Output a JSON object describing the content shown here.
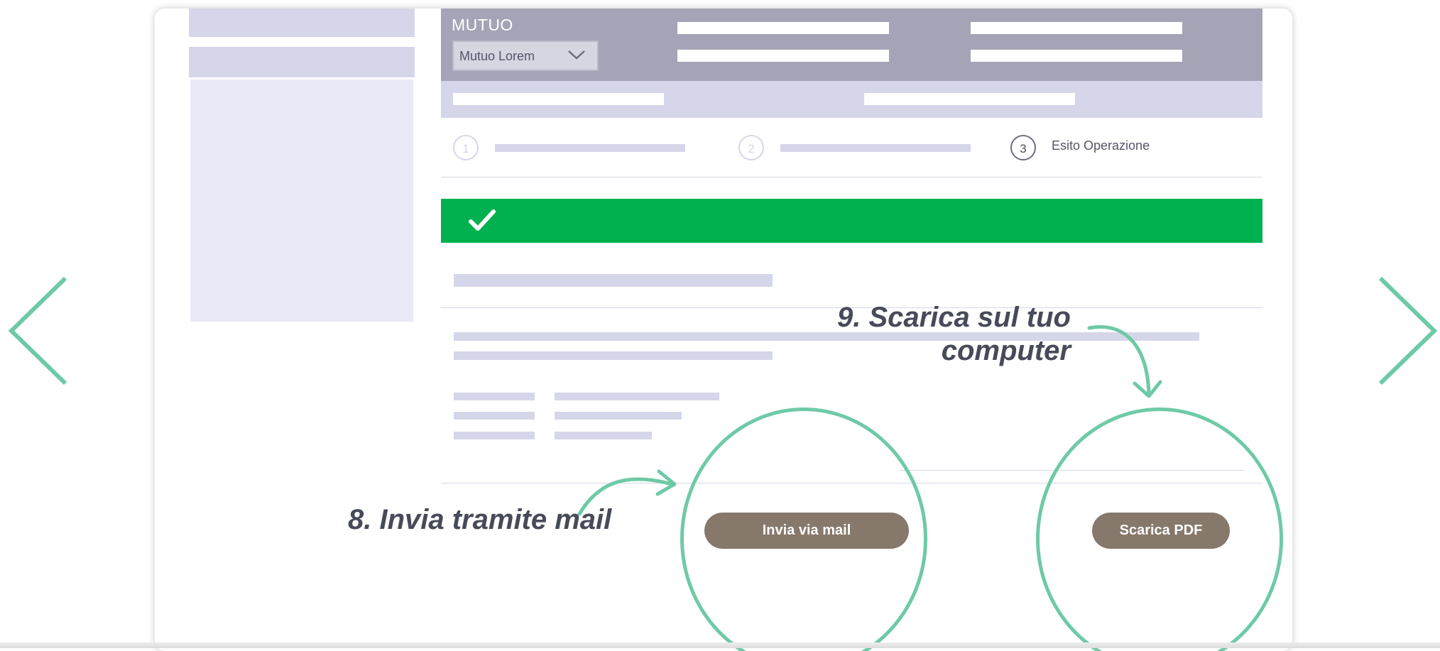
{
  "header": {
    "title": "MUTUO",
    "product_select": {
      "value": "Mutuo Lorem"
    }
  },
  "steps": [
    {
      "number": "1",
      "label": ""
    },
    {
      "number": "2",
      "label": ""
    },
    {
      "number": "3",
      "label": "Esito Operazione"
    }
  ],
  "actions": {
    "send_mail_label": "Invia via mail",
    "download_pdf_label": "Scarica PDF"
  },
  "annotations": {
    "mail": "8. Invia tramite mail",
    "download_line1": "9. Scarica sul tuo",
    "download_line2": "computer"
  },
  "icons": {
    "success": "checkmark-icon",
    "select": "chevron-down-icon",
    "prev": "chevron-left-icon",
    "next": "chevron-right-icon"
  },
  "colors": {
    "accent": "#6ecaa6",
    "success": "#01b14f",
    "button": "#86786b",
    "header": "#a5a4b6",
    "placeholder": "#d6d6ea"
  }
}
